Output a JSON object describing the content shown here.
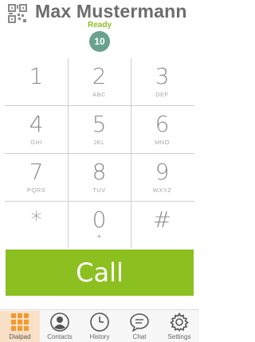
{
  "header": {
    "user_name": "Max Mustermann",
    "status": "Ready",
    "badge_count": "10",
    "qr_icon": "qr-code-icon"
  },
  "dialpad": {
    "keys": [
      {
        "digit": "1",
        "letters": ""
      },
      {
        "digit": "2",
        "letters": "ABC"
      },
      {
        "digit": "3",
        "letters": "DEF"
      },
      {
        "digit": "4",
        "letters": "GHI"
      },
      {
        "digit": "5",
        "letters": "JKL"
      },
      {
        "digit": "6",
        "letters": "MNO"
      },
      {
        "digit": "7",
        "letters": "PQRS"
      },
      {
        "digit": "8",
        "letters": "TUV"
      },
      {
        "digit": "9",
        "letters": "WXYZ"
      },
      {
        "digit": "*",
        "letters": ""
      },
      {
        "digit": "0",
        "letters": "+"
      },
      {
        "digit": "#",
        "letters": ""
      }
    ]
  },
  "call_button": {
    "label": "Call"
  },
  "tabbar": {
    "active": "Dialpad",
    "tabs": [
      {
        "label": "Dialpad",
        "icon": "dialpad-grid-icon"
      },
      {
        "label": "Contacts",
        "icon": "contacts-person-icon"
      },
      {
        "label": "History",
        "icon": "history-clock-icon"
      },
      {
        "label": "Chat",
        "icon": "chat-bubble-icon"
      },
      {
        "label": "Settings",
        "icon": "settings-gear-icon"
      }
    ]
  },
  "colors": {
    "accent_green": "#8cc020",
    "status_green": "#8cbf26",
    "badge_teal": "#6aa28f",
    "active_tab_bg": "#fbe0c8",
    "dialpad_orange": "#f39a2e"
  }
}
